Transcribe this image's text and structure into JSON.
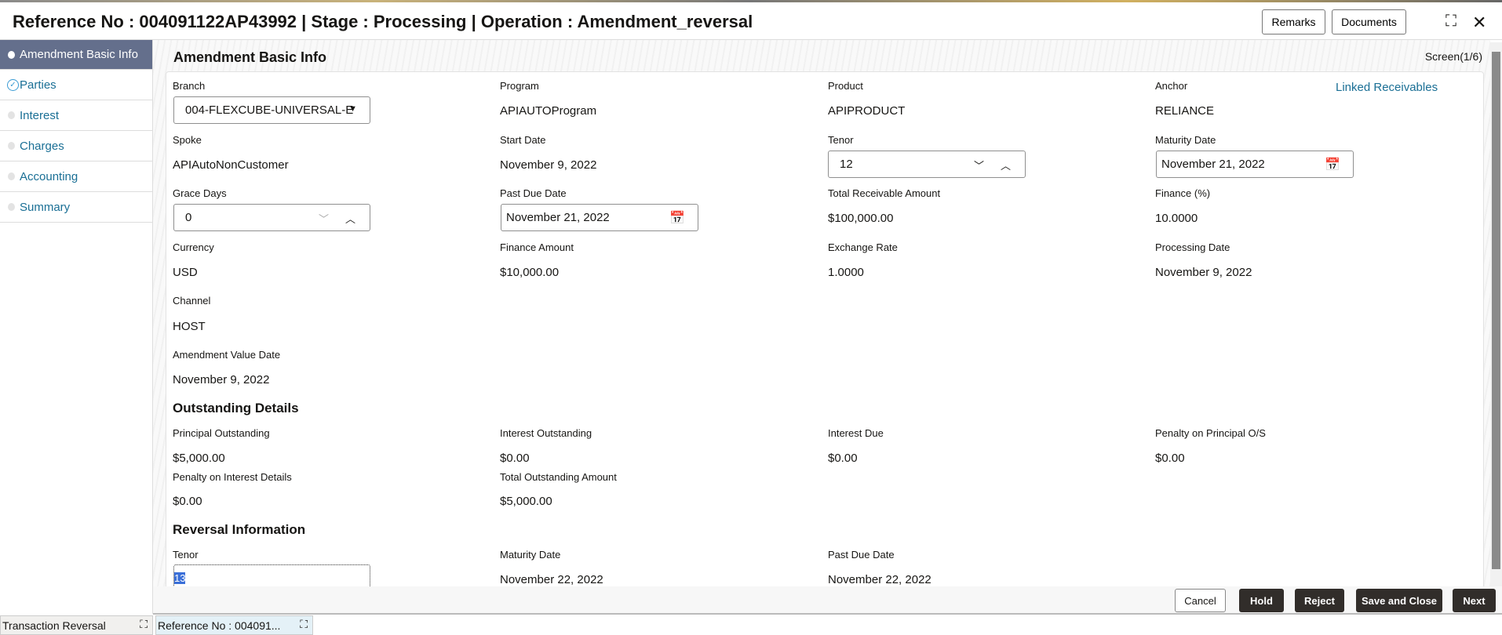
{
  "header": {
    "title": "Reference No : 004091122AP43992 | Stage : Processing | Operation : Amendment_reversal",
    "remarks": "Remarks",
    "documents": "Documents"
  },
  "sidebar": {
    "items": [
      {
        "label": "Amendment Basic Info",
        "state": "active"
      },
      {
        "label": "Parties",
        "state": "completed"
      },
      {
        "label": "Interest"
      },
      {
        "label": "Charges"
      },
      {
        "label": "Accounting"
      },
      {
        "label": "Summary"
      }
    ]
  },
  "main": {
    "section_title": "Amendment Basic Info",
    "screen": "Screen(1/6)",
    "linked_receivables": "Linked Receivables",
    "fields": {
      "branch": {
        "label": "Branch",
        "value": "004-FLEXCUBE-UNIVERSAL-E"
      },
      "program": {
        "label": "Program",
        "value": "APIAUTOProgram"
      },
      "product": {
        "label": "Product",
        "value": "APIPRODUCT"
      },
      "anchor": {
        "label": "Anchor",
        "value": "RELIANCE"
      },
      "spoke": {
        "label": "Spoke",
        "value": "APIAutoNonCustomer"
      },
      "start_date": {
        "label": "Start Date",
        "value": "November 9, 2022"
      },
      "tenor": {
        "label": "Tenor",
        "value": "12"
      },
      "maturity_date": {
        "label": "Maturity Date",
        "value": "November 21, 2022"
      },
      "grace_days": {
        "label": "Grace Days",
        "value": "0"
      },
      "past_due_date": {
        "label": "Past Due Date",
        "value": "November 21, 2022"
      },
      "total_receivable": {
        "label": "Total Receivable Amount",
        "value": "$100,000.00"
      },
      "finance_pct": {
        "label": "Finance (%)",
        "value": "10.0000"
      },
      "currency": {
        "label": "Currency",
        "value": "USD"
      },
      "finance_amount": {
        "label": "Finance Amount",
        "value": "$10,000.00"
      },
      "exchange_rate": {
        "label": "Exchange Rate",
        "value": "1.0000"
      },
      "processing_date": {
        "label": "Processing Date",
        "value": "November 9, 2022"
      },
      "channel": {
        "label": "Channel",
        "value": "HOST"
      },
      "amendment_value_date": {
        "label": "Amendment Value Date",
        "value": "November 9, 2022"
      }
    },
    "outstanding": {
      "title": "Outstanding Details",
      "principal": {
        "label": "Principal Outstanding",
        "value": "$5,000.00"
      },
      "interest": {
        "label": "Interest Outstanding",
        "value": "$0.00"
      },
      "interest_due": {
        "label": "Interest Due",
        "value": "$0.00"
      },
      "penalty_principal": {
        "label": "Penalty on Principal O/S",
        "value": "$0.00"
      },
      "penalty_interest": {
        "label": "Penalty on Interest Details",
        "value": "$0.00"
      },
      "total": {
        "label": "Total Outstanding Amount",
        "value": "$5,000.00"
      }
    },
    "reversal": {
      "title": "Reversal Information",
      "tenor": {
        "label": "Tenor",
        "value": "13"
      },
      "maturity_date": {
        "label": "Maturity Date",
        "value": "November 22, 2022"
      },
      "past_due_date": {
        "label": "Past Due Date",
        "value": "November 22, 2022"
      }
    }
  },
  "footer": {
    "cancel": "Cancel",
    "hold": "Hold",
    "reject": "Reject",
    "save_close": "Save and Close",
    "next": "Next"
  },
  "tabs": [
    {
      "label": "Transaction Reversal"
    },
    {
      "label": "Reference No : 004091..."
    }
  ]
}
